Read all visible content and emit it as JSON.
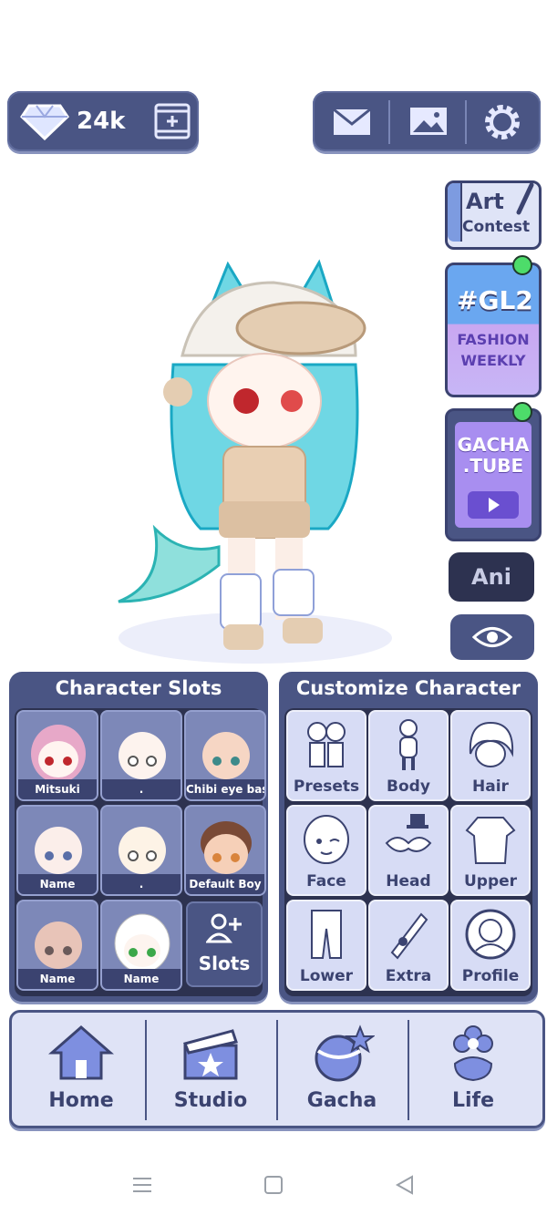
{
  "currency": {
    "gems": "24k",
    "gem_icon": "diamond-icon",
    "ad_icon": "film-add-icon"
  },
  "top_menu": {
    "mail_icon": "mail-icon",
    "gallery_icon": "image-icon",
    "settings_icon": "gear-icon"
  },
  "side_buttons": {
    "art_contest": {
      "line1": "Art",
      "line2": "Contest"
    },
    "gl2": {
      "tag": "#GL2",
      "line1": "FASHION",
      "line2": "WEEKLY"
    },
    "gacha_tube": {
      "line1": "GACHA",
      "line2": ".TUBE"
    },
    "ani": "Ani",
    "eye_icon": "eye-icon"
  },
  "character_slots": {
    "title": "Character Slots",
    "slots": [
      {
        "label": "Mitsuki"
      },
      {
        "label": "."
      },
      {
        "label": "Chibi eye base"
      },
      {
        "label": "Name"
      },
      {
        "label": "."
      },
      {
        "label": "Default Boy"
      },
      {
        "label": "Name"
      },
      {
        "label": "Name"
      }
    ],
    "add_slots": "Slots"
  },
  "customize": {
    "title": "Customize Character",
    "items": [
      {
        "label": "Presets"
      },
      {
        "label": "Body"
      },
      {
        "label": "Hair"
      },
      {
        "label": "Face"
      },
      {
        "label": "Head"
      },
      {
        "label": "Upper"
      },
      {
        "label": "Lower"
      },
      {
        "label": "Extra"
      },
      {
        "label": "Profile"
      }
    ]
  },
  "bottom_nav": [
    {
      "label": "Home"
    },
    {
      "label": "Studio"
    },
    {
      "label": "Gacha"
    },
    {
      "label": "Life"
    }
  ],
  "colors": {
    "panel": "#4a5584",
    "panel_dark": "#2d3250",
    "accent": "#a88ef0",
    "online_dot": "#4ddc6a"
  }
}
